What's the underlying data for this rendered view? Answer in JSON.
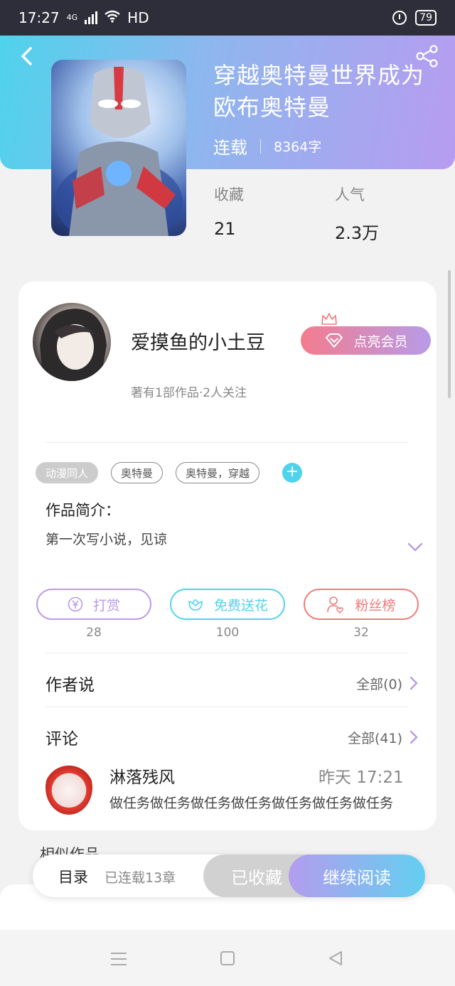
{
  "status_bar": {
    "time": "17:27",
    "network": "4G",
    "hd": "HD",
    "battery": "79"
  },
  "header": {
    "book_title": "穿越奥特曼世界成为欧布奥特曼",
    "status": "连载",
    "word_count": "8364字",
    "stats": [
      {
        "label": "收藏",
        "value": "21"
      },
      {
        "label": "人气",
        "value": "2.3万"
      }
    ]
  },
  "author": {
    "name": "爱摸鱼的小土豆",
    "summary": "著有1部作品·2人关注",
    "vip_button": "点亮会员"
  },
  "tags": [
    "动漫同人",
    "奥特曼",
    "奥特曼，穿越"
  ],
  "intro": {
    "title": "作品简介：",
    "text": "第一次写小说，见谅"
  },
  "actions": [
    {
      "label": "打赏",
      "count": "28",
      "color": "#b79be8"
    },
    {
      "label": "免费送花",
      "count": "100",
      "color": "#4fd3ec"
    },
    {
      "label": "粉丝榜",
      "count": "32",
      "color": "#f07a7a"
    }
  ],
  "author_says": {
    "title": "作者说",
    "link": "全部(0)"
  },
  "comments": {
    "title": "评论",
    "link": "全部(41)",
    "first": {
      "user": "淋落残风",
      "time": "昨天 17:21",
      "text": "做任务做任务做任务做任务做任务做任务做任务"
    }
  },
  "similar_title": "相似作品",
  "bottom_bar": {
    "toc_label": "目录",
    "toc_sub": "已连载13章",
    "collected": "已收藏",
    "continue": "继续阅读"
  },
  "colors": {
    "accent_cyan": "#4fd3ec",
    "accent_purple": "#b79be8",
    "accent_red": "#f07a7a"
  }
}
